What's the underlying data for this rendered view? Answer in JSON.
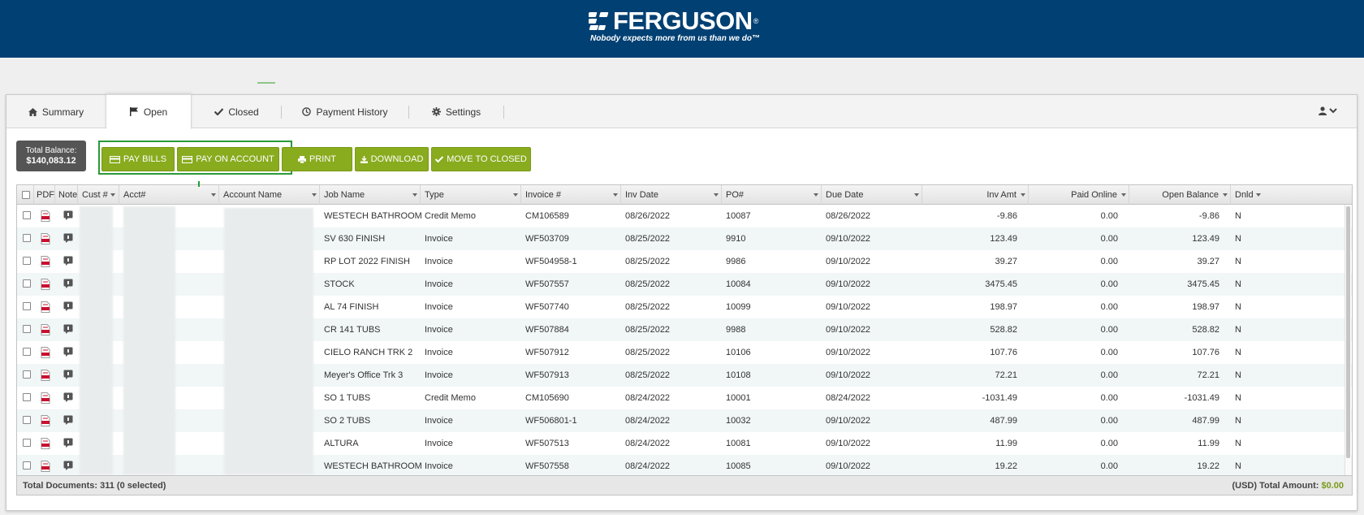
{
  "brand": {
    "name": "FERGUSON",
    "tagline": "Nobody expects more from us than we do™",
    "color": "#004073"
  },
  "tabs": [
    {
      "label": "Summary",
      "icon": "home-icon",
      "active": false
    },
    {
      "label": "Open",
      "icon": "flag-icon",
      "active": true
    },
    {
      "label": "Closed",
      "icon": "check-icon",
      "active": false
    },
    {
      "label": "Payment History",
      "icon": "clock-icon",
      "active": false
    },
    {
      "label": "Settings",
      "icon": "gear-icon",
      "active": false
    }
  ],
  "balance": {
    "label": "Total Balance:",
    "value": "$140,083.12"
  },
  "actions": {
    "pay_bills": "PAY BILLS",
    "pay_on_account": "PAY ON ACCOUNT",
    "print": "PRINT",
    "download": "DOWNLOAD",
    "move_to_closed": "MOVE TO CLOSED"
  },
  "columns": {
    "pdf": "PDF",
    "note": "Note",
    "cust": "Cust #",
    "acct": "Acct#",
    "account_name": "Account Name",
    "job": "Job Name",
    "type": "Type",
    "invoice": "Invoice #",
    "inv_date": "Inv Date",
    "po": "PO#",
    "due": "Due Date",
    "inv_amt": "Inv Amt",
    "paid_online": "Paid Online",
    "open_balance": "Open Balance",
    "dnld": "Dnld"
  },
  "rows": [
    {
      "job": "WESTECH BATHROOM",
      "type": "Credit Memo",
      "invoice": "CM106589",
      "inv_date": "08/26/2022",
      "po": "10087",
      "due": "08/26/2022",
      "inv_amt": "-9.86",
      "paid_online": "0.00",
      "open_balance": "-9.86",
      "dnld": "N"
    },
    {
      "job": "SV 630 FINISH",
      "type": "Invoice",
      "invoice": "WF503709",
      "inv_date": "08/25/2022",
      "po": "9910",
      "due": "09/10/2022",
      "inv_amt": "123.49",
      "paid_online": "0.00",
      "open_balance": "123.49",
      "dnld": "N"
    },
    {
      "job": "RP LOT 2022 FINISH",
      "type": "Invoice",
      "invoice": "WF504958-1",
      "inv_date": "08/25/2022",
      "po": "9986",
      "due": "09/10/2022",
      "inv_amt": "39.27",
      "paid_online": "0.00",
      "open_balance": "39.27",
      "dnld": "N"
    },
    {
      "job": "STOCK",
      "type": "Invoice",
      "invoice": "WF507557",
      "inv_date": "08/25/2022",
      "po": "10084",
      "due": "09/10/2022",
      "inv_amt": "3475.45",
      "paid_online": "0.00",
      "open_balance": "3475.45",
      "dnld": "N"
    },
    {
      "job": "AL 74 FINISH",
      "type": "Invoice",
      "invoice": "WF507740",
      "inv_date": "08/25/2022",
      "po": "10099",
      "due": "09/10/2022",
      "inv_amt": "198.97",
      "paid_online": "0.00",
      "open_balance": "198.97",
      "dnld": "N"
    },
    {
      "job": "CR 141 TUBS",
      "type": "Invoice",
      "invoice": "WF507884",
      "inv_date": "08/25/2022",
      "po": "9988",
      "due": "09/10/2022",
      "inv_amt": "528.82",
      "paid_online": "0.00",
      "open_balance": "528.82",
      "dnld": "N"
    },
    {
      "job": "CIELO RANCH TRK 2",
      "type": "Invoice",
      "invoice": "WF507912",
      "inv_date": "08/25/2022",
      "po": "10106",
      "due": "09/10/2022",
      "inv_amt": "107.76",
      "paid_online": "0.00",
      "open_balance": "107.76",
      "dnld": "N"
    },
    {
      "job": "Meyer's Office Trk 3",
      "type": "Invoice",
      "invoice": "WF507913",
      "inv_date": "08/25/2022",
      "po": "10108",
      "due": "09/10/2022",
      "inv_amt": "72.21",
      "paid_online": "0.00",
      "open_balance": "72.21",
      "dnld": "N"
    },
    {
      "job": "SO 1 TUBS",
      "type": "Credit Memo",
      "invoice": "CM105690",
      "inv_date": "08/24/2022",
      "po": "10001",
      "due": "08/24/2022",
      "inv_amt": "-1031.49",
      "paid_online": "0.00",
      "open_balance": "-1031.49",
      "dnld": "N"
    },
    {
      "job": "SO 2 TUBS",
      "type": "Invoice",
      "invoice": "WF506801-1",
      "inv_date": "08/24/2022",
      "po": "10032",
      "due": "09/10/2022",
      "inv_amt": "487.99",
      "paid_online": "0.00",
      "open_balance": "487.99",
      "dnld": "N"
    },
    {
      "job": "ALTURA",
      "type": "Invoice",
      "invoice": "WF507513",
      "inv_date": "08/24/2022",
      "po": "10081",
      "due": "09/10/2022",
      "inv_amt": "11.99",
      "paid_online": "0.00",
      "open_balance": "11.99",
      "dnld": "N"
    },
    {
      "job": "WESTECH BATHROOM",
      "type": "Invoice",
      "invoice": "WF507558",
      "inv_date": "08/24/2022",
      "po": "10085",
      "due": "09/10/2022",
      "inv_amt": "19.22",
      "paid_online": "0.00",
      "open_balance": "19.22",
      "dnld": "N"
    }
  ],
  "footer": {
    "total_docs": "Total Documents: 311 (0 selected)",
    "total_label": "(USD) Total Amount:",
    "total_value": "$0.00"
  },
  "colors": {
    "button_green": "#89ab1e",
    "highlight_green": "#2a9a3a",
    "row_alt": "#f1f6f6"
  }
}
